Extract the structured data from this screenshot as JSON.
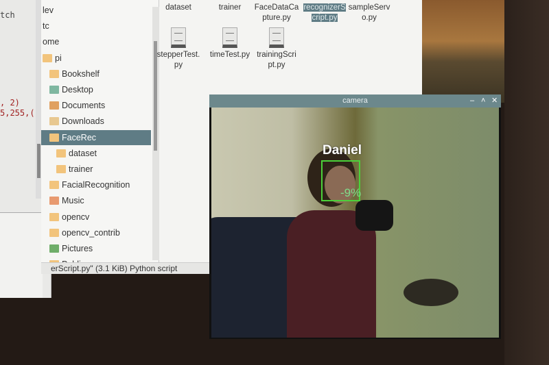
{
  "editor": {
    "lines": [
      "tch",
      ", 2)",
      "5,255,("
    ]
  },
  "tree": {
    "items": [
      {
        "label": "lev",
        "icon": "none"
      },
      {
        "label": "tc",
        "icon": "none"
      },
      {
        "label": "ome",
        "icon": "none"
      },
      {
        "label": "pi",
        "icon": "folder"
      },
      {
        "label": "Bookshelf",
        "icon": "folder"
      },
      {
        "label": "Desktop",
        "icon": "desktop"
      },
      {
        "label": "Documents",
        "icon": "documents"
      },
      {
        "label": "Downloads",
        "icon": "downloads"
      },
      {
        "label": "FaceRec",
        "icon": "folder",
        "selected": true
      },
      {
        "label": "dataset",
        "icon": "folder",
        "indent": true
      },
      {
        "label": "trainer",
        "icon": "folder",
        "indent": true
      },
      {
        "label": "FacialRecognition",
        "icon": "folder"
      },
      {
        "label": "Music",
        "icon": "music"
      },
      {
        "label": "opencv",
        "icon": "folder"
      },
      {
        "label": "opencv_contrib",
        "icon": "folder"
      },
      {
        "label": "Pictures",
        "icon": "pictures"
      },
      {
        "label": "Public",
        "icon": "folder"
      }
    ]
  },
  "files": [
    {
      "label": "dataset"
    },
    {
      "label": "trainer"
    },
    {
      "label": "FaceDataCa pture.py"
    },
    {
      "label": "recognizerS cript.py",
      "selected": true
    },
    {
      "label": "sampleServ o.py"
    },
    {
      "label": "stepperTest. py"
    },
    {
      "label": "timeTest.py"
    },
    {
      "label": "trainingScri pt.py"
    }
  ],
  "status": "erScript.py\" (3.1 KiB) Python script",
  "camera": {
    "title": "camera",
    "buttons": [
      "–",
      "˄",
      "✕"
    ],
    "name": "Daniel",
    "confidence": "-9%",
    "box_color": "#4bd23a"
  },
  "colors": {
    "selection": "#5f7c85",
    "titlebar": "#6c888c"
  }
}
